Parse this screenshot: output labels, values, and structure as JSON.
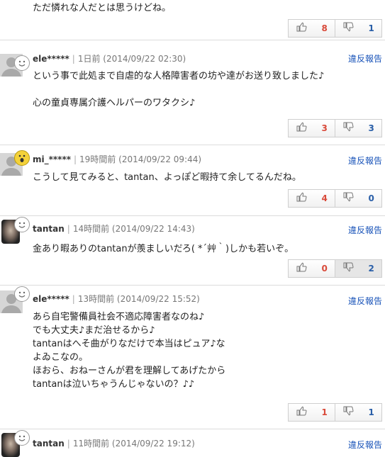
{
  "report_label": "違反報告",
  "comments": [
    {
      "user": "",
      "time": "",
      "lines": [
        "ただ憐れな人だとは思うけどね。"
      ],
      "good": "8",
      "bad": "1"
    },
    {
      "user": "ele*****",
      "time": "1日前 (2014/09/22 02:30)",
      "lines": [
        "という事で此処まで自虐的な人格障害者の坊や達がお送り致しました♪",
        "",
        "心の童貞専属介護ヘルパーのワタクシ♪"
      ],
      "good": "3",
      "bad": "3"
    },
    {
      "user": "mi_*****",
      "time": "19時間前 (2014/09/22 09:44)",
      "lines": [
        "こうして見てみると、tantan、よっぽど暇持て余してるんだね。"
      ],
      "good": "4",
      "bad": "0"
    },
    {
      "user": "tantan",
      "time": "14時間前 (2014/09/22 14:43)",
      "lines": [
        "金あり暇ありのtantanが羨ましいだろ( *´艸｀)しかも若いぞ。"
      ],
      "good": "0",
      "bad": "2"
    },
    {
      "user": "ele*****",
      "time": "13時間前 (2014/09/22 15:52)",
      "lines": [
        "あら自宅警備員社会不適応障害者なのね♪",
        "でも大丈夫♪まだ治せるから♪",
        "tantanはへそ曲がりなだけで本当はピュア♪な",
        "よゐこなの。",
        "ほおら、おねーさんが君を理解してあげたから",
        "tantanは泣いちゃうんじゃないの？♪♪"
      ],
      "good": "1",
      "bad": "1"
    },
    {
      "user": "tantan",
      "time": "11時間前 (2014/09/22 19:12)",
      "lines": [],
      "good": "",
      "bad": ""
    }
  ]
}
